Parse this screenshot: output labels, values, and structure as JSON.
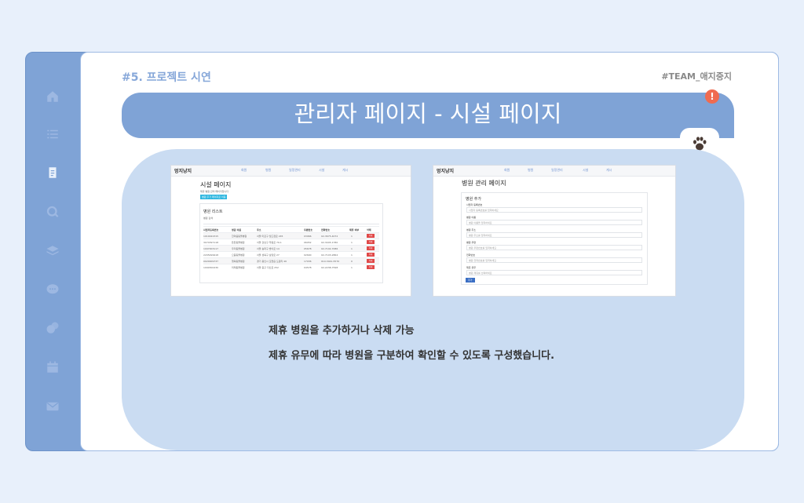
{
  "header": {
    "section_label": "#5. 프로젝트 시연",
    "team_label": "#TEAM_애지중지"
  },
  "banner": {
    "title": "관리자 페이지 - 시설 페이지",
    "alert_glyph": "!"
  },
  "sidebar": {
    "icons": [
      "home-icon",
      "list-icon",
      "clipboard-icon",
      "search-icon",
      "layers-icon",
      "chat-icon",
      "users-icon",
      "calendar-icon",
      "mail-icon"
    ]
  },
  "screenshot_left": {
    "brand": "멍지냥지",
    "nav": [
      "회원",
      "병원",
      "일정관리",
      "시설",
      "게시"
    ],
    "page_title": "시설 페이지",
    "subtitle": "제휴 병원 관리 페이지입니다",
    "add_button": "병원 추가 페이지로 이동",
    "card_title": "병원 리스트",
    "search_label": "병원 검색",
    "columns": [
      "사업자등록번호",
      "병원 이름",
      "주소",
      "우편번호",
      "전화번호",
      "제휴 여부",
      "삭제"
    ],
    "rows": [
      [
        "1010022315",
        "한마음동물병원",
        "서울 마포구 월드컵로 245",
        "03966",
        "02-3675-4072",
        "1",
        "삭제"
      ],
      [
        "3074397118",
        "튼튼동물병원",
        "서울 강남구 학동로 79-1",
        "06052",
        "02-3445-1780",
        "1",
        "삭제"
      ],
      [
        "1097003117",
        "우리동물병원",
        "서울 송파구 방이로 14",
        "05678",
        "02-7102-7086",
        "1",
        "삭제"
      ],
      [
        "2205499918",
        "으뜸동물병원",
        "서울 성북구 삼양로 27",
        "02690",
        "02-7103-2864",
        "1",
        "삭제"
      ],
      [
        "0020009737",
        "행복동물병원",
        "경기 용인시 모현읍 도원리 46",
        "17036",
        "010-3441-5570",
        "0",
        "삭제"
      ],
      [
        "1090300230",
        "미래동물병원",
        "서울 중구 다산로 252",
        "04578",
        "02-2238-7598",
        "1",
        "삭제"
      ]
    ]
  },
  "screenshot_right": {
    "brand": "멍지냥지",
    "nav": [
      "회원",
      "병원",
      "일정관리",
      "시설",
      "게시"
    ],
    "page_title": "병원 관리 페이지",
    "card_title": "병원 추가",
    "fields": [
      {
        "label": "사업자 등록번호",
        "placeholder": "사업자 등록번호를 입력하세요"
      },
      {
        "label": "병원 이름",
        "placeholder": "병원 이름을 입력하세요"
      },
      {
        "label": "병원 주소",
        "placeholder": "병원 주소를 입력하세요"
      },
      {
        "label": "병원 우편",
        "placeholder": "병원 우편번호를 입력하세요"
      },
      {
        "label": "전화번호",
        "placeholder": "병원 전화번호를 입력하세요"
      },
      {
        "label": "제휴 유무",
        "placeholder": "병원 제휴를 선택하세요"
      }
    ],
    "submit": "추가"
  },
  "description": {
    "line1": "제휴 병원을 추가하거나 삭제 가능",
    "line2": "제휴 유무에 따라 병원을 구분하여 확인할 수 있도록 구성했습니다."
  },
  "colors": {
    "accent": "#7fa3d6",
    "panel": "#cadcf2",
    "alert": "#f06b50",
    "background": "#e8f0fb"
  }
}
